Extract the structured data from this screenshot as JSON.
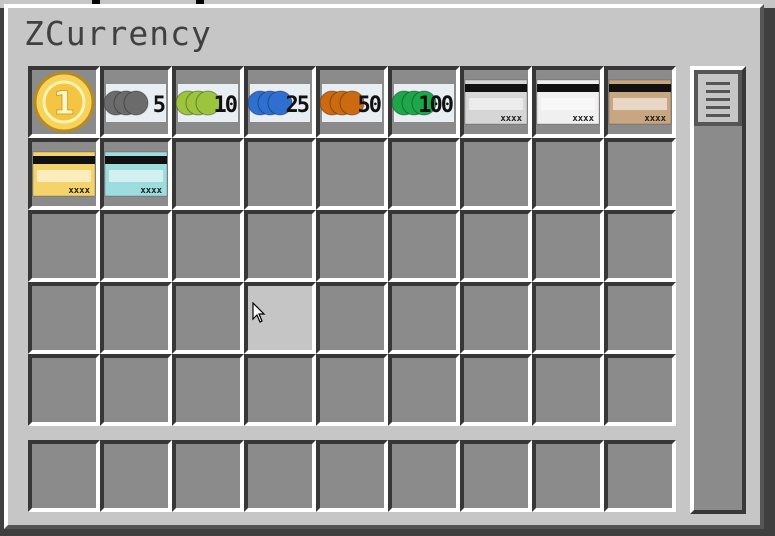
{
  "window": {
    "title": "ZCurrency"
  },
  "items": [
    {
      "slot": 0,
      "name": "coin-1-icon",
      "kind": "coin",
      "label": "1"
    },
    {
      "slot": 1,
      "name": "chip-5-icon",
      "kind": "chip",
      "color": "#6b6b6b",
      "label": "5"
    },
    {
      "slot": 2,
      "name": "chip-10-icon",
      "kind": "chip",
      "color": "#9cc43c",
      "label": "10"
    },
    {
      "slot": 3,
      "name": "chip-25-icon",
      "kind": "chip",
      "color": "#2f6fd0",
      "label": "25"
    },
    {
      "slot": 4,
      "name": "chip-50-icon",
      "kind": "chip",
      "color": "#cc6a12",
      "label": "50"
    },
    {
      "slot": 5,
      "name": "chip-100-icon",
      "kind": "chip",
      "color": "#1ea64a",
      "label": "100"
    },
    {
      "slot": 6,
      "name": "card-silver-icon",
      "kind": "card",
      "color": "#d6d6d6",
      "label": "xxxx"
    },
    {
      "slot": 7,
      "name": "card-white-icon",
      "kind": "card",
      "color": "#f0f0f0",
      "label": "xxxx"
    },
    {
      "slot": 8,
      "name": "card-bronze-icon",
      "kind": "card",
      "color": "#c8a682",
      "label": "xxxx"
    },
    {
      "slot": 9,
      "name": "card-gold-icon",
      "kind": "card",
      "color": "#f4d46a",
      "label": "xxxx"
    },
    {
      "slot": 10,
      "name": "card-cyan-icon",
      "kind": "card",
      "color": "#9ddde0",
      "label": "xxxx"
    }
  ],
  "inventory": {
    "hovered_slot": 30
  }
}
